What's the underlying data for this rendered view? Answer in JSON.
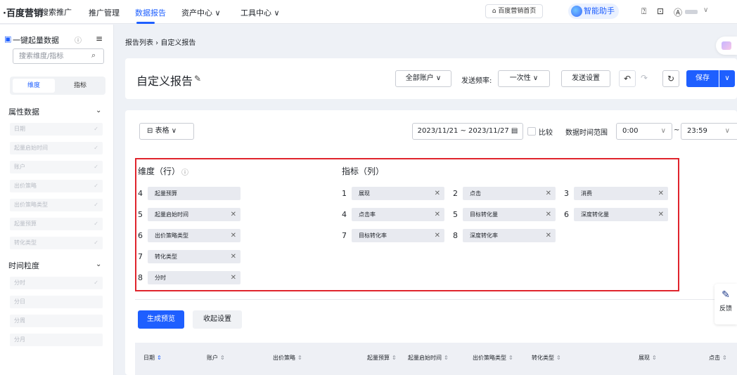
{
  "nav": {
    "logo": "·百度营销",
    "logo_sub": "搜索推广",
    "items": [
      {
        "label": "推广管理"
      },
      {
        "label": "数据报告"
      },
      {
        "label": "资产中心 ∨"
      },
      {
        "label": "工具中心 ∨"
      }
    ],
    "home_link": "⌂ 百度营销首页",
    "ai_assistant": "智能助手",
    "user_menu_chevron": "∨"
  },
  "sidebar": {
    "title": "一键起量数据",
    "search_placeholder": "搜索维度/指标",
    "tabs": {
      "dimension": "维度",
      "metric": "指标"
    },
    "groups": [
      {
        "title": "属性数据",
        "items": [
          "日期",
          "起量启始时间",
          "账户",
          "出价策略",
          "出价策略类型",
          "起量预算",
          "转化类型"
        ]
      },
      {
        "title": "时间粒度",
        "items": [
          "分时",
          "分日",
          "分周",
          "分月"
        ]
      }
    ]
  },
  "breadcrumb": "报告列表 › 自定义报告",
  "header": {
    "title": "自定义报告",
    "account_select": "全部账户 ∨",
    "freq_label": "发送频率:",
    "freq_select": "一次性 ∨",
    "send_settings": "发送设置",
    "save": "保存"
  },
  "toolbar": {
    "view_select": "表格 ∨",
    "date_range": "2023/11/21 ~ 2023/11/27",
    "compare_label": "比较",
    "time_range_label": "数据时间范围",
    "time_start": "0:00",
    "time_sep": "~",
    "time_end": "23:59"
  },
  "dimensions": {
    "title": "维度（行）",
    "items": [
      {
        "num": "4",
        "label": "起量预算",
        "removable": false
      },
      {
        "num": "5",
        "label": "起量启始时间",
        "removable": true
      },
      {
        "num": "6",
        "label": "出价策略类型",
        "removable": true
      },
      {
        "num": "7",
        "label": "转化类型",
        "removable": true
      },
      {
        "num": "8",
        "label": "分时",
        "removable": true
      }
    ]
  },
  "metrics": {
    "title": "指标（列）",
    "items": [
      {
        "num": "1",
        "label": "展现"
      },
      {
        "num": "2",
        "label": "点击"
      },
      {
        "num": "3",
        "label": "消费"
      },
      {
        "num": "4",
        "label": "点击率"
      },
      {
        "num": "5",
        "label": "目标转化量"
      },
      {
        "num": "6",
        "label": "深度转化量"
      },
      {
        "num": "7",
        "label": "目标转化率"
      },
      {
        "num": "8",
        "label": "深度转化率"
      }
    ]
  },
  "actions": {
    "preview": "生成预览",
    "collapse": "收起设置"
  },
  "table": {
    "columns": [
      "日期",
      "账户",
      "出价策略",
      "起量预算",
      "起量启始时间",
      "出价策略类型",
      "转化类型",
      "展现",
      "点击"
    ]
  },
  "feedback": "反馈",
  "colors": {
    "accent": "#1e5fff",
    "highlight_border": "#e0242c"
  }
}
